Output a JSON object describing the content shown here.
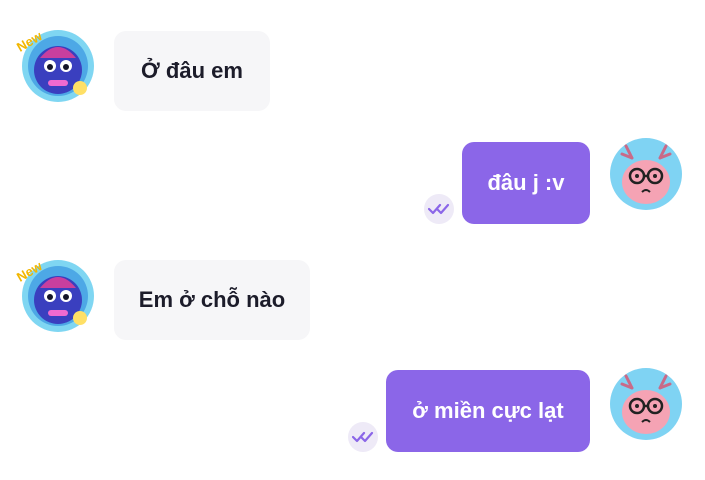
{
  "colors": {
    "incoming_bubble": "#f6f6f8",
    "outgoing_bubble": "#8b66e8",
    "incoming_text": "#1c1c2a",
    "outgoing_text": "#ffffff",
    "seen_check": "#8b66e8"
  },
  "messages": [
    {
      "direction": "incoming",
      "text": "Ở đâu em",
      "avatar": "blue-monster-avatar",
      "avatar_badge": "New"
    },
    {
      "direction": "outgoing",
      "text": "đâu j :v",
      "avatar": "pink-creature-with-glasses-avatar",
      "status": "seen-icon"
    },
    {
      "direction": "incoming",
      "text": "Em ở chỗ nào",
      "avatar": "blue-monster-avatar",
      "avatar_badge": "New"
    },
    {
      "direction": "outgoing",
      "text": "ở miền cực lạt",
      "avatar": "pink-creature-with-glasses-avatar",
      "status": "seen-icon"
    }
  ]
}
